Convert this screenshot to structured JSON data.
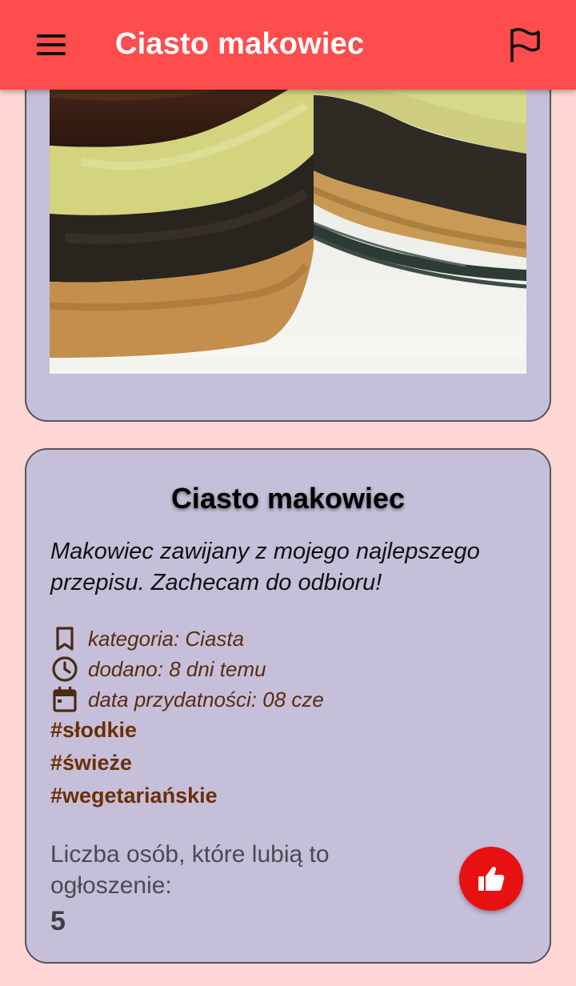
{
  "appbar": {
    "title": "Ciasto makowiec",
    "menu_icon": "menu-icon",
    "flag_icon": "flag-icon",
    "background": "#ff4c4c"
  },
  "photo": {
    "subject": "makowiec"
  },
  "card": {
    "title": "Ciasto makowiec",
    "description": "Makowiec zawijany z mojego najlepszego przepisu. Zachecam do odbioru!",
    "meta": [
      {
        "icon": "bookmark-icon",
        "text": "kategoria: Ciasta"
      },
      {
        "icon": "clock-icon",
        "text": "dodano: 8 dni temu"
      },
      {
        "icon": "calendar-icon",
        "text": "data przydatności: 08 cze"
      }
    ],
    "tags": [
      "#słodkie",
      "#świeże",
      "#wegetariańskie"
    ],
    "likes_label": "Liczba osób, które lubią to ogłoszenie:",
    "likes_count": "5",
    "like_icon": "thumbs-up-icon",
    "like_button_color": "#e81111"
  },
  "colors": {
    "page_background": "#ffd6d6",
    "card_background": "#c5bfda",
    "meta_text": "#5a2b0c",
    "tag_text": "#6b2e06"
  }
}
